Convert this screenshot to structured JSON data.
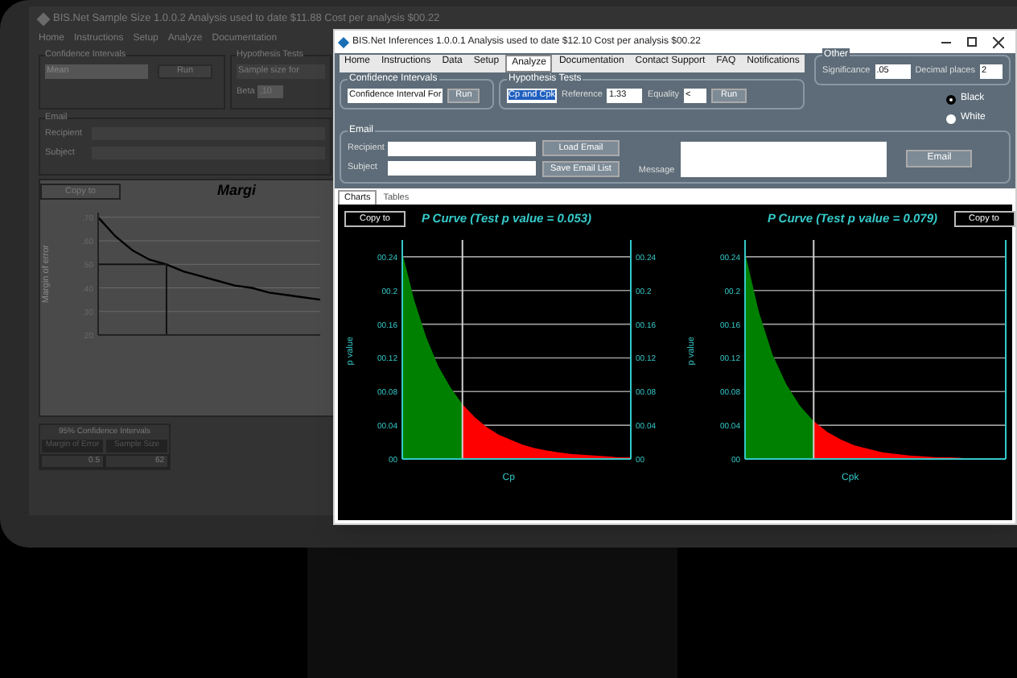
{
  "background_window": {
    "title": "BIS.Net Sample Size 1.0.0.2 Analysis used to date $11.88 Cost per analysis $00.22",
    "menu": [
      "Home",
      "Instructions",
      "Setup",
      "Analyze",
      "Documentation"
    ],
    "confidence_intervals": {
      "label": "Confidence Intervals",
      "dropdown": "Mean",
      "run": "Run"
    },
    "hypothesis_tests": {
      "label": "Hypothesis Tests",
      "dropdown": "Sample size for",
      "beta_label": "Beta",
      "beta_value": ".10"
    },
    "email": {
      "label": "Email",
      "recipient_label": "Recipient",
      "subject_label": "Subject"
    },
    "copy_button": "Copy to",
    "chart_data": {
      "type": "line",
      "title": "Margi",
      "ylabel": "Margin of error",
      "ylim": [
        0.2,
        0.72
      ],
      "yticks": [
        {
          "value": 0.7,
          "label": ".70"
        },
        {
          "value": 0.6,
          "label": ".60"
        },
        {
          "value": 0.5,
          "label": ".50"
        },
        {
          "value": 0.4,
          "label": ".40"
        },
        {
          "value": 0.3,
          "label": ".30"
        },
        {
          "value": 0.2,
          "label": ".20"
        }
      ],
      "series": [
        {
          "color": "#000000",
          "values": [
            0.7,
            0.62,
            0.56,
            0.52,
            0.5,
            0.47,
            0.45,
            0.43,
            0.41,
            0.4,
            0.38,
            0.37,
            0.36,
            0.35
          ]
        }
      ],
      "grid": true,
      "ref_lines": [
        {
          "axis": "y",
          "value": 0.5
        }
      ]
    },
    "table": {
      "title": "95% Confidence Intervals",
      "columns": [
        "Margin of Error",
        "Sample Size"
      ],
      "rows": [
        [
          "0.5",
          "62"
        ]
      ]
    }
  },
  "window": {
    "title": "BIS.Net Inferences 1.0.0.1 Analysis used to date $12.10 Cost per analysis $00.22",
    "menu": [
      {
        "label": "Home",
        "selected": false
      },
      {
        "label": "Instructions",
        "selected": false
      },
      {
        "label": "Data",
        "selected": false
      },
      {
        "label": "Setup",
        "selected": false
      },
      {
        "label": "Analyze",
        "selected": true
      },
      {
        "label": "Documentation",
        "selected": false
      },
      {
        "label": "Contact Support",
        "selected": false
      },
      {
        "label": "FAQ",
        "selected": false
      },
      {
        "label": "Notifications",
        "selected": false
      }
    ],
    "confidence_intervals": {
      "label": "Confidence Intervals",
      "dropdown": "Confidence Interval For",
      "run": "Run"
    },
    "hypothesis_tests": {
      "label": "Hypothesis Tests",
      "dropdown": "Cp and Cpk",
      "reference_label": "Reference",
      "reference_value": "1.33",
      "equality_label": "Equality",
      "equality_value": "<",
      "run": "Run"
    },
    "other": {
      "label": "Other",
      "significance_label": "Significance",
      "significance_value": ".05",
      "decimal_label": "Decimal places",
      "decimal_value": "2"
    },
    "theme_options": [
      {
        "label": "Black",
        "selected": true
      },
      {
        "label": "White",
        "selected": false
      }
    ],
    "email": {
      "label": "Email",
      "recipient_label": "Recipient",
      "subject_label": "Subject",
      "load": "Load Email",
      "save": "Save Email List",
      "message_label": "Message",
      "send": "Email"
    },
    "tabs": [
      {
        "label": "Charts",
        "selected": true
      },
      {
        "label": "Tables",
        "selected": false
      }
    ],
    "charts": [
      {
        "copy_button": "Copy to",
        "mirror_yticks": true,
        "chart_data": {
          "type": "area",
          "title": "P Curve (Test p value = 0.053)",
          "xlabel": "Cp",
          "ylabel": "p value",
          "ylim": [
            0,
            0.26
          ],
          "yticks": [
            {
              "value": 0.24,
              "label": "00.24"
            },
            {
              "value": 0.2,
              "label": "00.2"
            },
            {
              "value": 0.16,
              "label": "00.16"
            },
            {
              "value": 0.12,
              "label": "00.12"
            },
            {
              "value": 0.08,
              "label": "00.08"
            },
            {
              "value": 0.04,
              "label": "00.04"
            },
            {
              "value": 0,
              "label": "00"
            }
          ],
          "series": [
            {
              "color": "#008000",
              "values": [
                0.245,
                0.188,
                0.144,
                0.11,
                0.085,
                0.065,
                null,
                null,
                null,
                null,
                null,
                null,
                null,
                null,
                null,
                null,
                null,
                null,
                null,
                null
              ]
            },
            {
              "color": "#ff0000",
              "values": [
                null,
                null,
                null,
                null,
                null,
                0.065,
                0.05,
                0.038,
                0.029,
                0.023,
                0.017,
                0.013,
                0.01,
                0.008,
                0.006,
                0.005,
                0.004,
                0.003,
                0.002,
                0.002
              ]
            }
          ],
          "grid": true
        }
      },
      {
        "copy_button": "Copy to",
        "mirror_yticks": false,
        "chart_data": {
          "type": "area",
          "title": "P Curve (Test p value = 0.079)",
          "xlabel": "Cpk",
          "ylabel": "p value",
          "ylim": [
            0,
            0.26
          ],
          "yticks": [
            {
              "value": 0.24,
              "label": "00.24"
            },
            {
              "value": 0.2,
              "label": "00.2"
            },
            {
              "value": 0.16,
              "label": "00.16"
            },
            {
              "value": 0.12,
              "label": "00.12"
            },
            {
              "value": 0.08,
              "label": "00.08"
            },
            {
              "value": 0.04,
              "label": "00.04"
            },
            {
              "value": 0,
              "label": "00"
            }
          ],
          "series": [
            {
              "color": "#008000",
              "values": [
                0.245,
                0.175,
                0.124,
                0.089,
                0.063,
                0.045,
                null,
                null,
                null,
                null,
                null,
                null,
                null,
                null,
                null,
                null,
                null,
                null,
                null,
                null
              ]
            },
            {
              "color": "#ff0000",
              "values": [
                null,
                null,
                null,
                null,
                null,
                0.045,
                0.032,
                0.023,
                0.016,
                0.012,
                0.008,
                0.006,
                0.004,
                0.003,
                0.002,
                0.002,
                0.001,
                0.001,
                0.001,
                0.0
              ]
            }
          ],
          "grid": true
        }
      }
    ]
  }
}
